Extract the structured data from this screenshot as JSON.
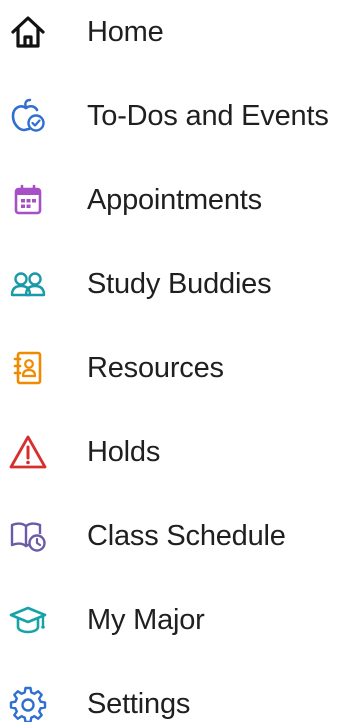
{
  "nav": {
    "items": [
      {
        "label": "Home",
        "icon": "home-icon",
        "color": "#111111"
      },
      {
        "label": "To-Dos and Events",
        "icon": "apple-check-icon",
        "color": "#2f6fd1"
      },
      {
        "label": "Appointments",
        "icon": "calendar-icon",
        "color": "#a64fc7"
      },
      {
        "label": "Study Buddies",
        "icon": "people-icon",
        "color": "#1a9aa6"
      },
      {
        "label": "Resources",
        "icon": "address-book-icon",
        "color": "#f08a00"
      },
      {
        "label": "Holds",
        "icon": "warning-icon",
        "color": "#d62f2f"
      },
      {
        "label": "Class Schedule",
        "icon": "book-clock-icon",
        "color": "#6a5aa8"
      },
      {
        "label": "My Major",
        "icon": "graduation-cap-icon",
        "color": "#16a3a8"
      },
      {
        "label": "Settings",
        "icon": "gear-icon",
        "color": "#2f6fd1"
      }
    ]
  }
}
